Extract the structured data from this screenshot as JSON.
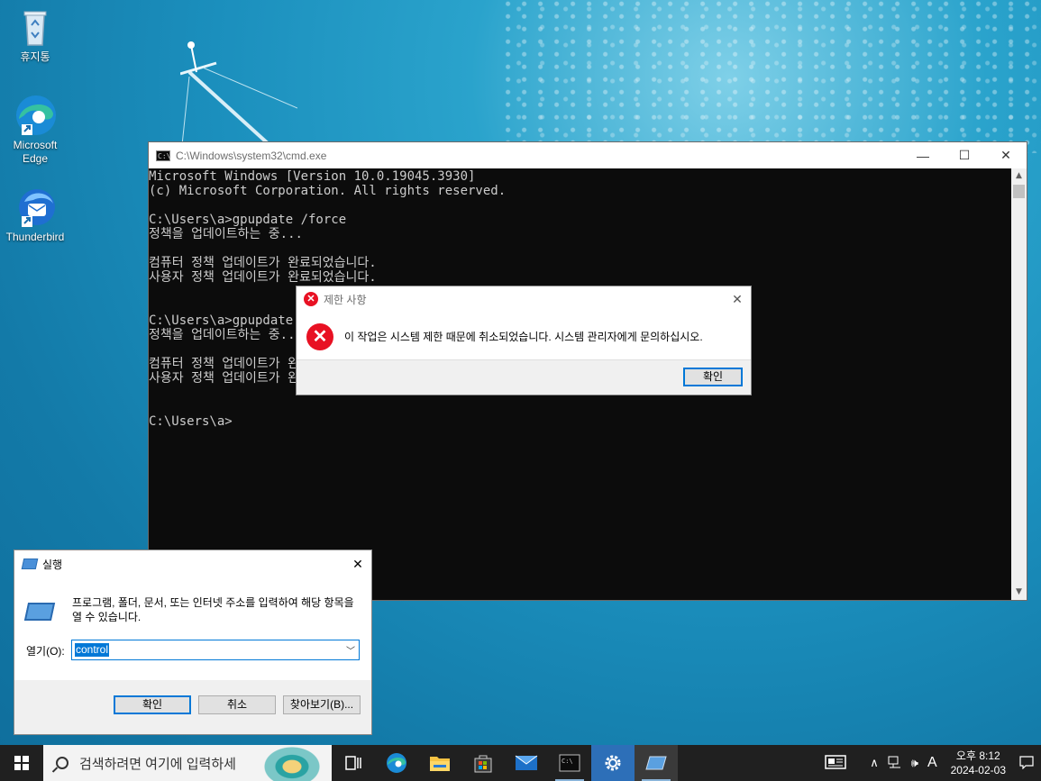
{
  "desktop": {
    "icons": [
      {
        "label": "휴지통",
        "icon": "recycle-bin-icon"
      },
      {
        "label": "Microsoft Edge",
        "icon": "edge-icon"
      },
      {
        "label": "Thunderbird",
        "icon": "thunderbird-icon"
      }
    ]
  },
  "cmd": {
    "title": "C:\\Windows\\system32\\cmd.exe",
    "output": "Microsoft Windows [Version 10.0.19045.3930]\n(c) Microsoft Corporation. All rights reserved.\n\nC:\\Users\\a>gpupdate /force\n정책을 업데이트하는 중...\n\n컴퓨터 정책 업데이트가 완료되었습니다.\n사용자 정책 업데이트가 완료되었습니다.\n\n\nC:\\Users\\a>gpupdate /force\n정책을 업데이트하는 중...\n\n컴퓨터 정책 업데이트가 완료되었습니다.\n사용자 정책 업데이트가 완료되었습니다.\n\n\nC:\\Users\\a>",
    "minimize": "—",
    "maximize": "☐",
    "close": "✕"
  },
  "error_dialog": {
    "title": "제한 사항",
    "message": "이 작업은 시스템 제한 때문에 취소되었습니다. 시스템 관리자에게 문의하십시오.",
    "ok_label": "확인",
    "close": "✕"
  },
  "run_dialog": {
    "title": "실행",
    "description": "프로그램, 폴더, 문서, 또는 인터넷 주소를 입력하여 해당 항목을 열 수 있습니다.",
    "open_label": "열기(O):",
    "input_value": "control",
    "ok_label": "확인",
    "cancel_label": "취소",
    "browse_label": "찾아보기(B)...",
    "close": "✕"
  },
  "taskbar": {
    "search_placeholder": "검색하려면 여기에 입력하세",
    "ime": "A",
    "time": "오후 8:12",
    "date": "2024-02-03"
  }
}
